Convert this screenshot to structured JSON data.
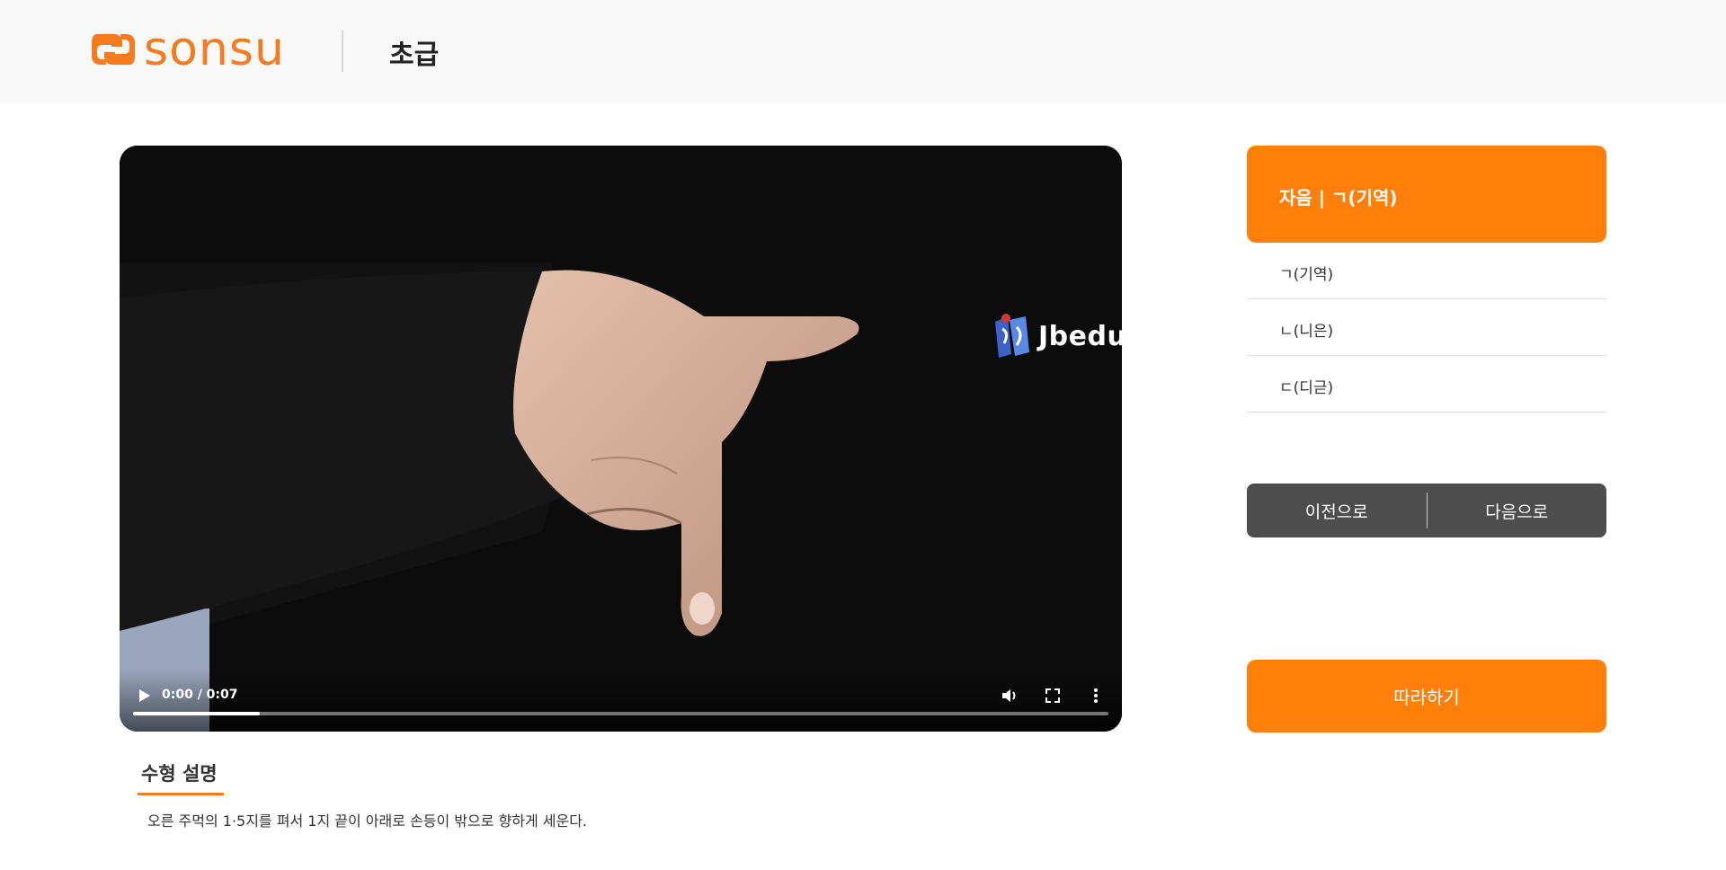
{
  "header": {
    "logo_text": "sonsu",
    "level": "초급"
  },
  "video": {
    "watermark": "Jbedu",
    "time": "0:00 / 0:07",
    "progress_loaded": 0.13,
    "icons": [
      "play-icon",
      "volume-icon",
      "fullscreen-icon",
      "more-icon"
    ]
  },
  "description": {
    "title": "수형 설명",
    "text": "오른 주먹의 1·5지를 펴서 1지 끝이 아래로 손등이 밖으로 향하게 세운다."
  },
  "sidebar": {
    "title": "자음 | ㄱ(기역)",
    "items": [
      {
        "label": "ㄱ(기역)"
      },
      {
        "label": "ㄴ(니은)"
      },
      {
        "label": "ㄷ(디귿)"
      }
    ],
    "prev_label": "이전으로",
    "next_label": "다음으로",
    "follow_label": "따라하기"
  },
  "colors": {
    "accent": "#ff7f0a",
    "brand": "#f47b20",
    "nav_bg": "#4d4d4d"
  }
}
